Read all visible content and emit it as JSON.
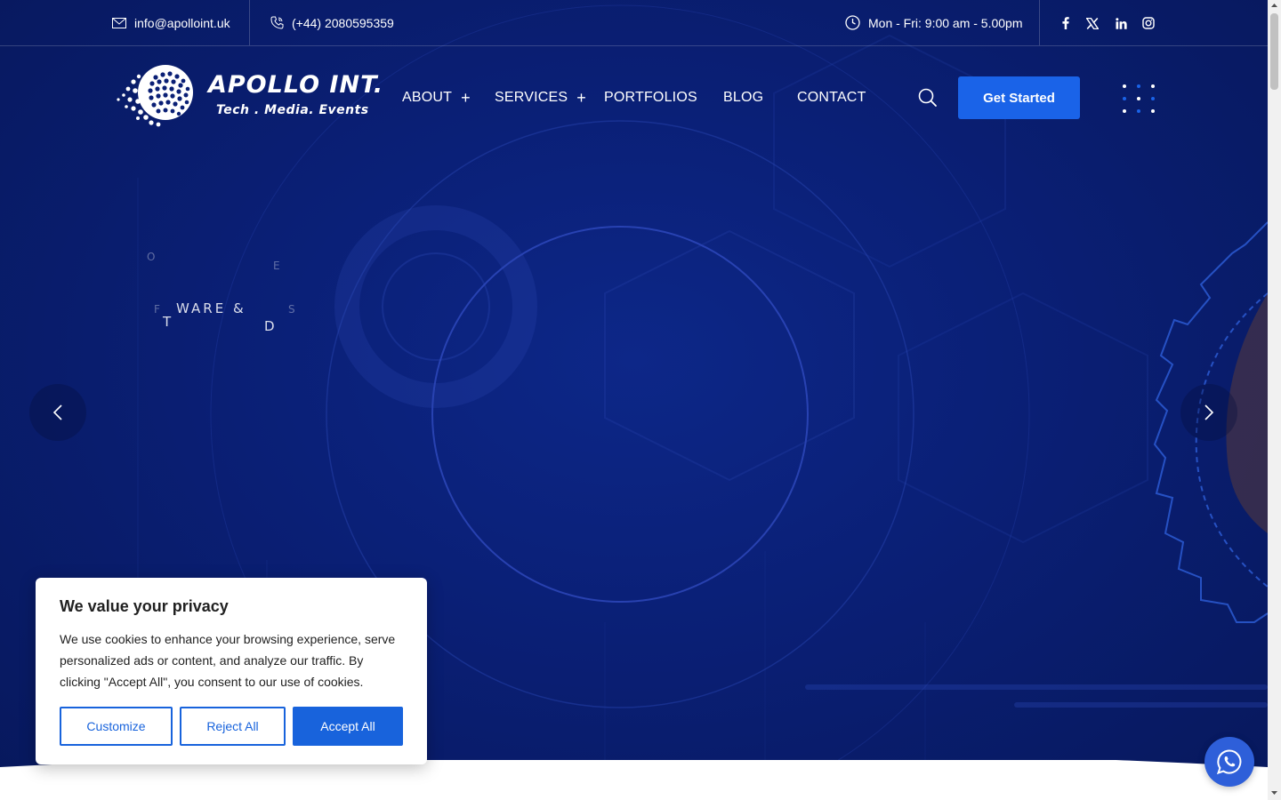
{
  "topbar": {
    "email": "info@apolloint.uk",
    "phone": "(+44) 2080595359",
    "hours": "Mon - Fri: 9:00 am - 5.00pm",
    "social": [
      "facebook-icon",
      "x-icon",
      "linkedin-icon",
      "instagram-icon"
    ]
  },
  "brand": {
    "name": "APOLLO INT.",
    "tagline": "Tech . Media. Events"
  },
  "nav": {
    "items": [
      {
        "label": "ABOUT",
        "has_submenu": true
      },
      {
        "label": "SERVICES",
        "has_submenu": true
      },
      {
        "label": "PORTFOLIOS",
        "has_submenu": false
      },
      {
        "label": "BLOG",
        "has_submenu": false
      },
      {
        "label": "CONTACT",
        "has_submenu": false
      }
    ],
    "cta_label": "Get Started"
  },
  "slider": {
    "fragments": {
      "o": "O",
      "e": "E",
      "f": "F",
      "ware": "WARE &",
      "s": "S",
      "t": "T",
      "d": "D"
    }
  },
  "cookie": {
    "title": "We value your privacy",
    "body": "We use cookies to enhance your browsing experience, serve personalized ads or content, and analyze our traffic. By clicking \"Accept All\", you consent to our use of cookies.",
    "customize_label": "Customize",
    "reject_label": "Reject All",
    "accept_label": "Accept All"
  },
  "colors": {
    "hero_bg": "#0a1f75",
    "accent": "#1a63e8",
    "cookie_accent": "#1863dc"
  }
}
